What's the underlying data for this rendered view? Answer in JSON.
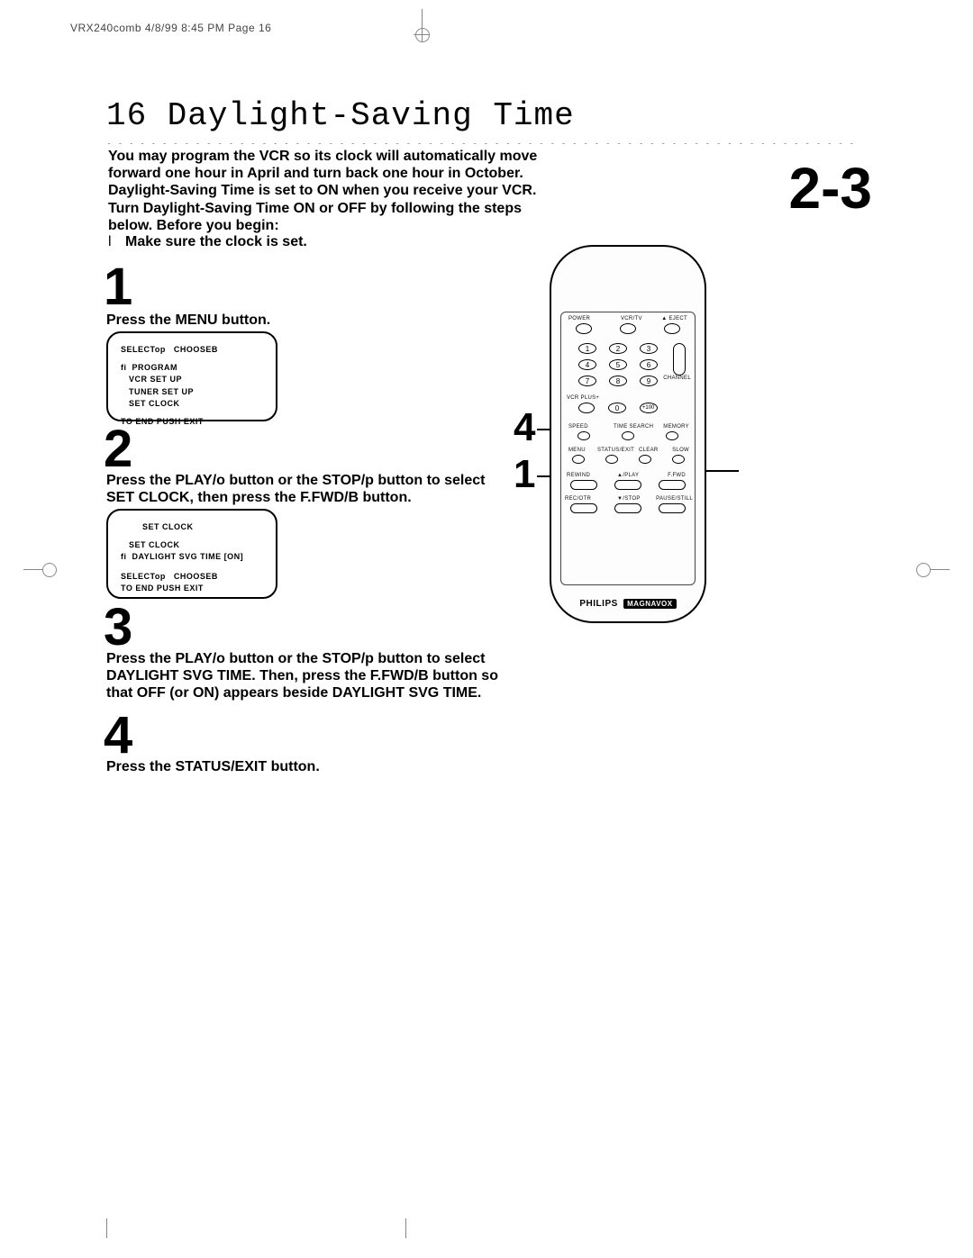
{
  "header": "VRX240comb  4/8/99 8:45 PM  Page 16",
  "page_number": "16",
  "title": "Daylight-Saving Time",
  "range_label": "2-3",
  "intro": "You may program the VCR so its clock will automatically move forward one hour in April and turn back one hour in October. Daylight-Saving Time is set to ON when you receive your VCR. Turn Daylight-Saving Time ON or OFF by following the steps below. Before you begin:",
  "bullet": "Make sure the clock is set.",
  "steps": {
    "s1": {
      "num": "1",
      "text": "Press the MENU button."
    },
    "s2": {
      "num": "2",
      "text": "Press the PLAY/o button or the STOP/p button to select SET CLOCK, then press the F.FWD/B button."
    },
    "s3": {
      "num": "3",
      "text": "Press the PLAY/o button or the STOP/p button to select DAYLIGHT SVG TIME. Then, press the F.FWD/B button so that OFF (or ON) appears beside DAYLIGHT SVG TIME."
    },
    "s4": {
      "num": "4",
      "text": "Press the STATUS/EXIT button."
    }
  },
  "screen1": {
    "line1": "SELECTop   CHOOSEB",
    "line2": "fi  PROGRAM",
    "line3": "   VCR SET UP",
    "line4": "   TUNER SET UP",
    "line5": "   SET CLOCK",
    "line6": "TO END PUSH EXIT"
  },
  "screen2": {
    "line1": "        SET CLOCK",
    "line2": "   SET CLOCK",
    "line3": "fi  DAYLIGHT SVG TIME [ON]",
    "line4": "SELECTop   CHOOSEB",
    "line5": "TO END PUSH EXIT"
  },
  "remote": {
    "row1": {
      "l1": "POWER",
      "l2": "VCR/TV",
      "l3": "▲ EJECT"
    },
    "nums": {
      "n1": "1",
      "n2": "2",
      "n3": "3",
      "n4": "4",
      "n5": "5",
      "n6": "6",
      "n7": "7",
      "n8": "8",
      "n9": "9",
      "vcrplus": "VCR PLUS+",
      "n0": "0",
      "n100": "+100"
    },
    "channel": "CHANNEL",
    "row_speed": {
      "l1": "SPEED",
      "l2": "TIME SEARCH",
      "l3": "MEMORY"
    },
    "row_menu": {
      "l1": "MENU",
      "l2": "STATUS/EXIT",
      "l3": "CLEAR",
      "l4": "SLOW"
    },
    "row_rew": {
      "l1": "REWIND",
      "l2": "▲/PLAY",
      "l3": "F.FWD"
    },
    "row_rec": {
      "l1": "REC/OTR",
      "l2": "▼/STOP",
      "l3": "PAUSE/STILL"
    },
    "brand1": "PHILIPS",
    "brand2": "MAGNAVOX"
  },
  "callouts": {
    "c4": "4",
    "c1": "1"
  },
  "dots": "••••••••••••••••••••••••••••••••••••••••••••••••••••••••••••••••••••••••••••••••••••••••••••••••••••••••••••••"
}
